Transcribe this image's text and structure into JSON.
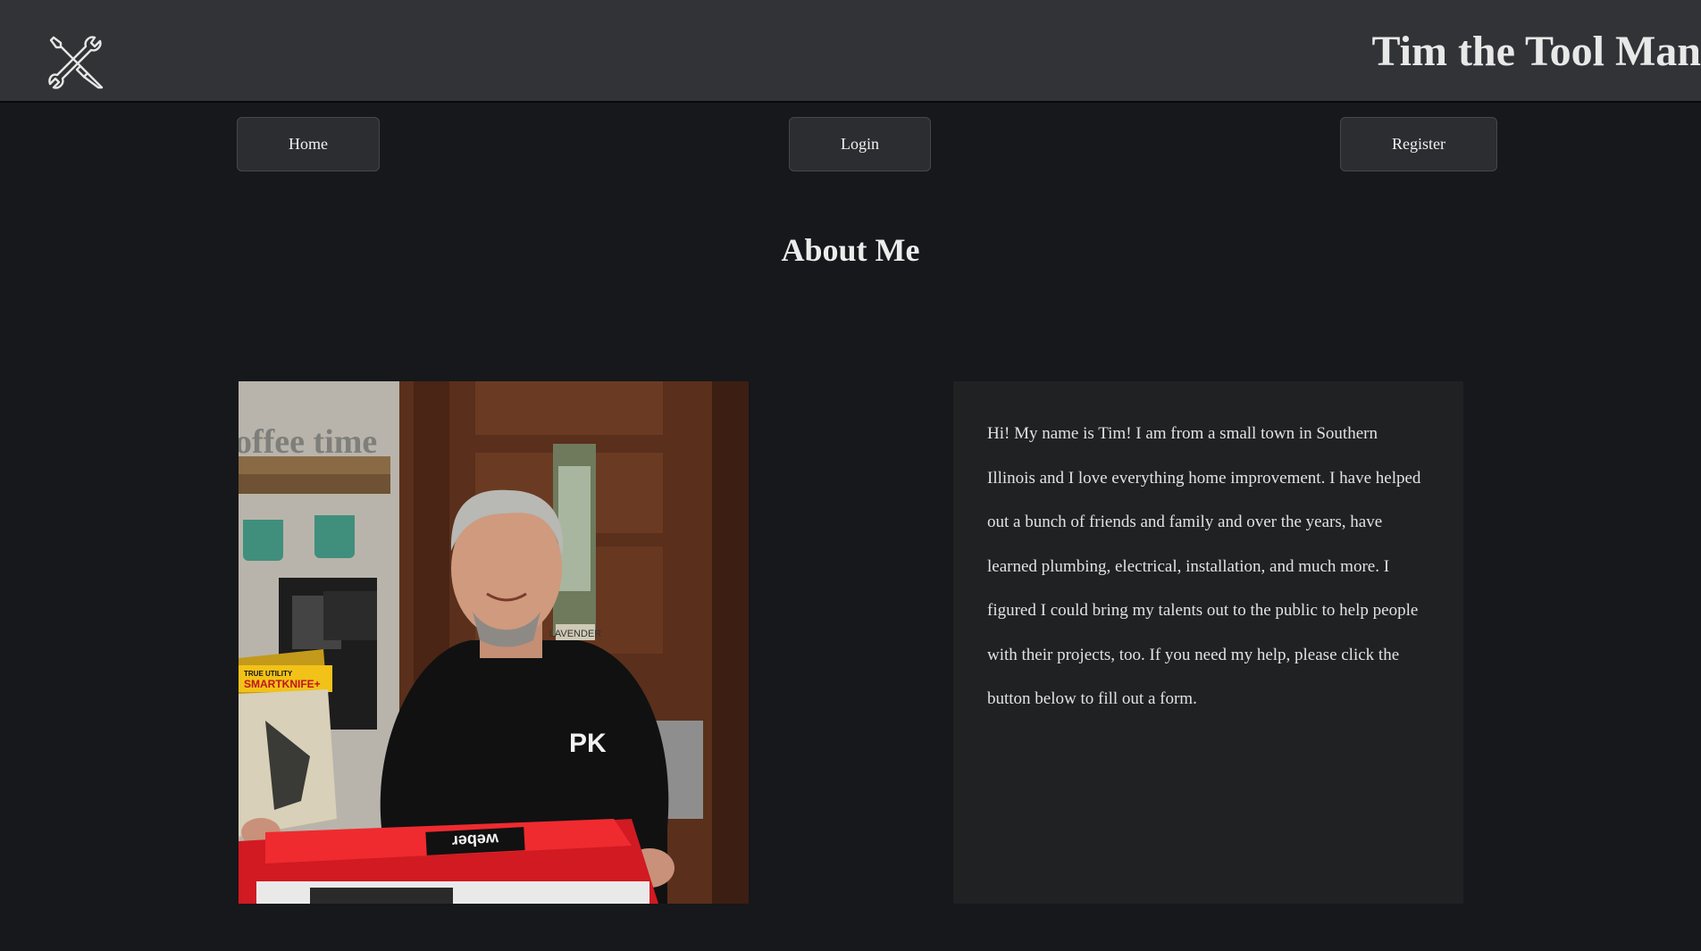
{
  "header": {
    "logo_icon": "tools-wrench-screwdriver-icon",
    "title": "Tim the Tool Man"
  },
  "nav": {
    "home_label": "Home",
    "login_label": "Login",
    "register_label": "Register"
  },
  "main": {
    "heading": "About Me",
    "photo": {
      "alt": "Tim holding a SMARTKNIFE+ utility knife package and a weber box",
      "mug_rack_sign": "offee time",
      "package_brand": "TRUE UTILITY",
      "package_label": "SMARTKNIFE+",
      "shirt_text": "PK",
      "box_text": "weber",
      "wall_plaque": "LAVENDER"
    },
    "bio": "Hi! My name is Tim! I am from a small town in Southern Illinois and I love everything home improvement. I have helped out a bunch of friends and family and over the years, have learned plumbing, electrical, installation, and much more. I figured I could bring my talents out to the public to help people with their projects, too. If you need my help, please click the button below to fill out a form."
  },
  "colors": {
    "background": "#16181b",
    "header_bg": "#323336",
    "button_bg": "#2c2d30",
    "card_bg": "#202123",
    "text": "#e4e4e4"
  }
}
